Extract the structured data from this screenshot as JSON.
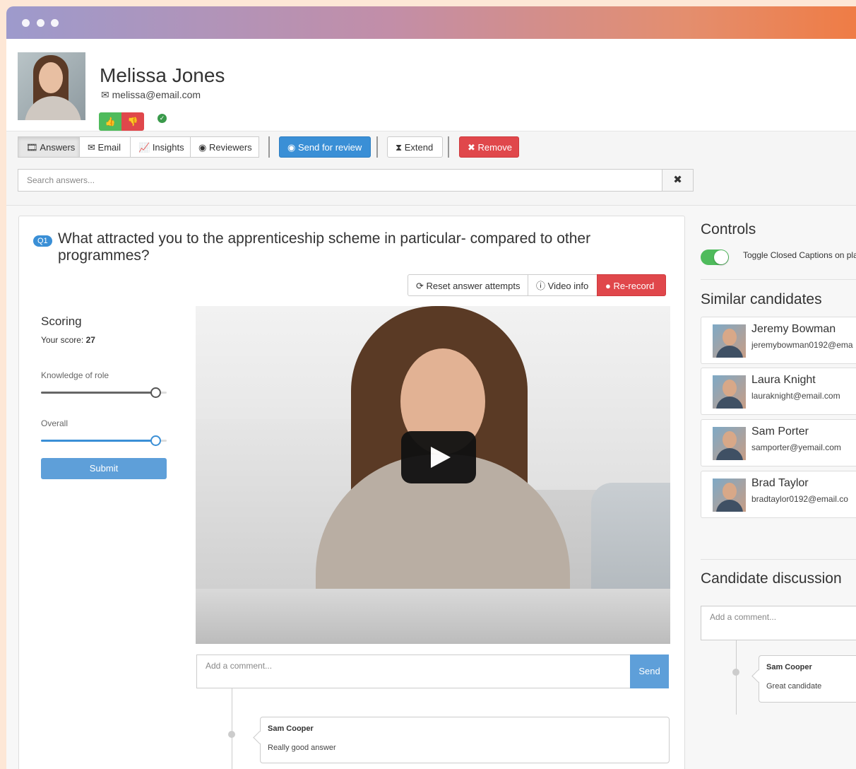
{
  "window": {
    "controls": [
      "close",
      "minimize",
      "maximize"
    ]
  },
  "candidate": {
    "name": "Melissa Jones",
    "email": "melissa@email.com",
    "approved_icon": "check-circle-icon"
  },
  "toolbar": {
    "tabs": [
      {
        "label": "Answers",
        "icon": "film-icon",
        "active": true
      },
      {
        "label": "Email",
        "icon": "envelope-icon"
      },
      {
        "label": "Insights",
        "icon": "chart-icon"
      },
      {
        "label": "Reviewers",
        "icon": "user-circle-icon"
      }
    ],
    "send_review": "Send for review",
    "extend": "Extend",
    "remove": "Remove"
  },
  "search": {
    "placeholder": "Search answers..."
  },
  "question": {
    "badge": "Q1",
    "text": "What attracted you to the apprenticeship scheme in particular- compared to other programmes?",
    "buttons": {
      "reset": "Reset answer attempts",
      "video_info": "Video info",
      "rerecord": "Re-record"
    }
  },
  "scoring": {
    "title": "Scoring",
    "score_label": "Your score: ",
    "score": "27",
    "sliders": [
      {
        "label": "Knowledge of role",
        "value": 0.91,
        "color": "#666666"
      },
      {
        "label": "Overall",
        "value": 0.91,
        "color": "#3a8fd6"
      }
    ],
    "submit": "Submit"
  },
  "answer_comments": {
    "placeholder": "Add a comment...",
    "send": "Send",
    "items": [
      {
        "author": "Sam Cooper",
        "text": "Really good answer"
      }
    ]
  },
  "controls": {
    "title": "Controls",
    "toggle_label": "Toggle Closed Captions on pla",
    "toggle_on": true
  },
  "similar": {
    "title": "Similar candidates",
    "items": [
      {
        "name": "Jeremy Bowman",
        "email": "jeremybowman0192@ema"
      },
      {
        "name": "Laura Knight",
        "email": "lauraknight@email.com"
      },
      {
        "name": "Sam Porter",
        "email": "samporter@yemail.com"
      },
      {
        "name": "Brad Taylor",
        "email": "bradtaylor0192@email.co"
      }
    ]
  },
  "discussion": {
    "title": "Candidate discussion",
    "placeholder": "Add a comment...",
    "items": [
      {
        "author": "Sam Cooper",
        "text": "Great candidate"
      }
    ]
  },
  "colors": {
    "accent": "#3a8fd6",
    "danger": "#e0474b",
    "success": "#4fbb5c"
  }
}
